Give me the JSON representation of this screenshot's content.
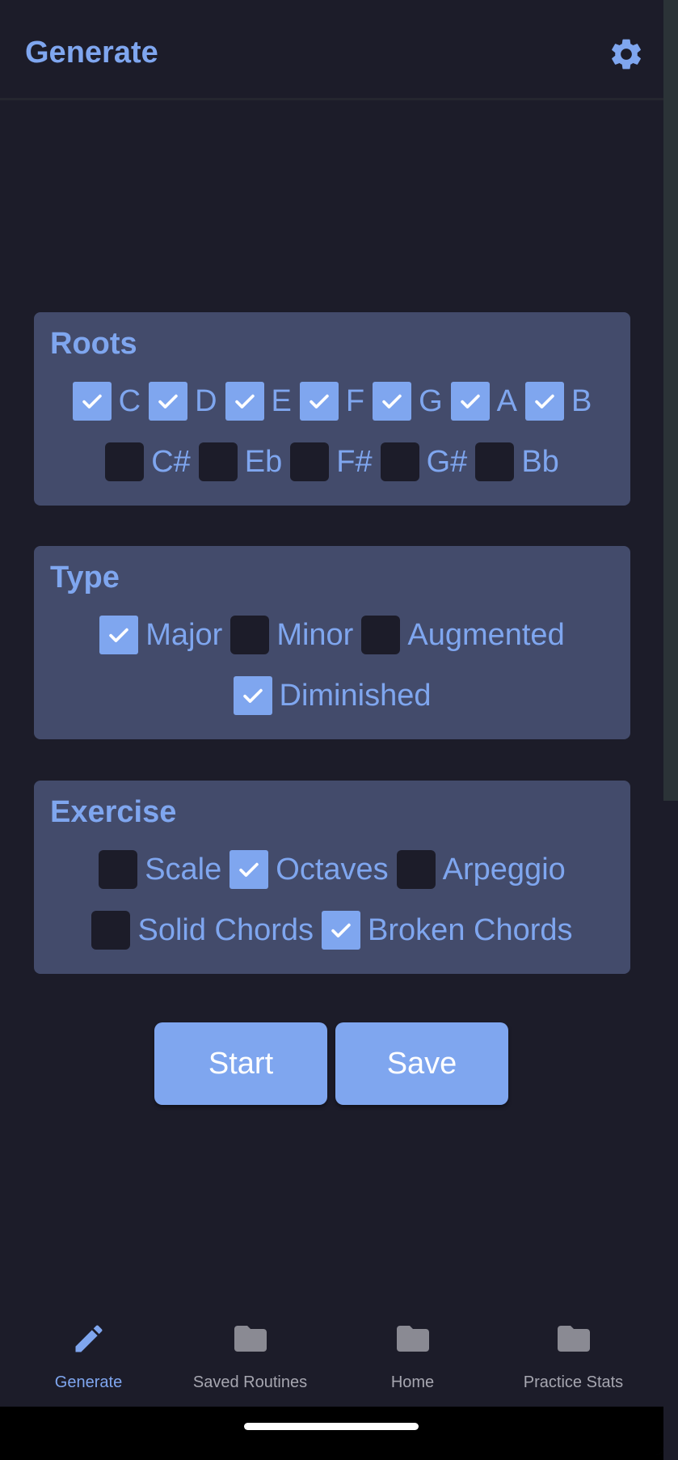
{
  "app_bar": {
    "title": "Generate",
    "settings_icon": "gear-icon"
  },
  "colors": {
    "accent": "#7fa6ef",
    "background": "#1c1c29",
    "card": "#434b6b"
  },
  "roots": {
    "title": "Roots",
    "row1": [
      {
        "label": "C",
        "checked": true
      },
      {
        "label": "D",
        "checked": true
      },
      {
        "label": "E",
        "checked": true
      },
      {
        "label": "F",
        "checked": true
      },
      {
        "label": "G",
        "checked": true
      },
      {
        "label": "A",
        "checked": true
      },
      {
        "label": "B",
        "checked": true
      }
    ],
    "row2": [
      {
        "label": "C#",
        "checked": false
      },
      {
        "label": "Eb",
        "checked": false
      },
      {
        "label": "F#",
        "checked": false
      },
      {
        "label": "G#",
        "checked": false
      },
      {
        "label": "Bb",
        "checked": false
      }
    ]
  },
  "type": {
    "title": "Type",
    "row1": [
      {
        "label": "Major",
        "checked": true
      },
      {
        "label": "Minor",
        "checked": false
      },
      {
        "label": "Augmented",
        "checked": false
      }
    ],
    "row2": [
      {
        "label": "Diminished",
        "checked": true
      }
    ]
  },
  "exercise": {
    "title": "Exercise",
    "row1": [
      {
        "label": "Scale",
        "checked": false
      },
      {
        "label": "Octaves",
        "checked": true
      },
      {
        "label": "Arpeggio",
        "checked": false
      }
    ],
    "row2": [
      {
        "label": "Solid Chords",
        "checked": false
      },
      {
        "label": "Broken Chords",
        "checked": true
      }
    ]
  },
  "actions": {
    "start_label": "Start",
    "save_label": "Save"
  },
  "bottom_nav": {
    "items": [
      {
        "label": "Generate",
        "icon": "pencil-icon",
        "active": true
      },
      {
        "label": "Saved Routines",
        "icon": "folder-icon",
        "active": false
      },
      {
        "label": "Home",
        "icon": "folder-icon",
        "active": false
      },
      {
        "label": "Practice Stats",
        "icon": "folder-icon",
        "active": false
      }
    ]
  }
}
